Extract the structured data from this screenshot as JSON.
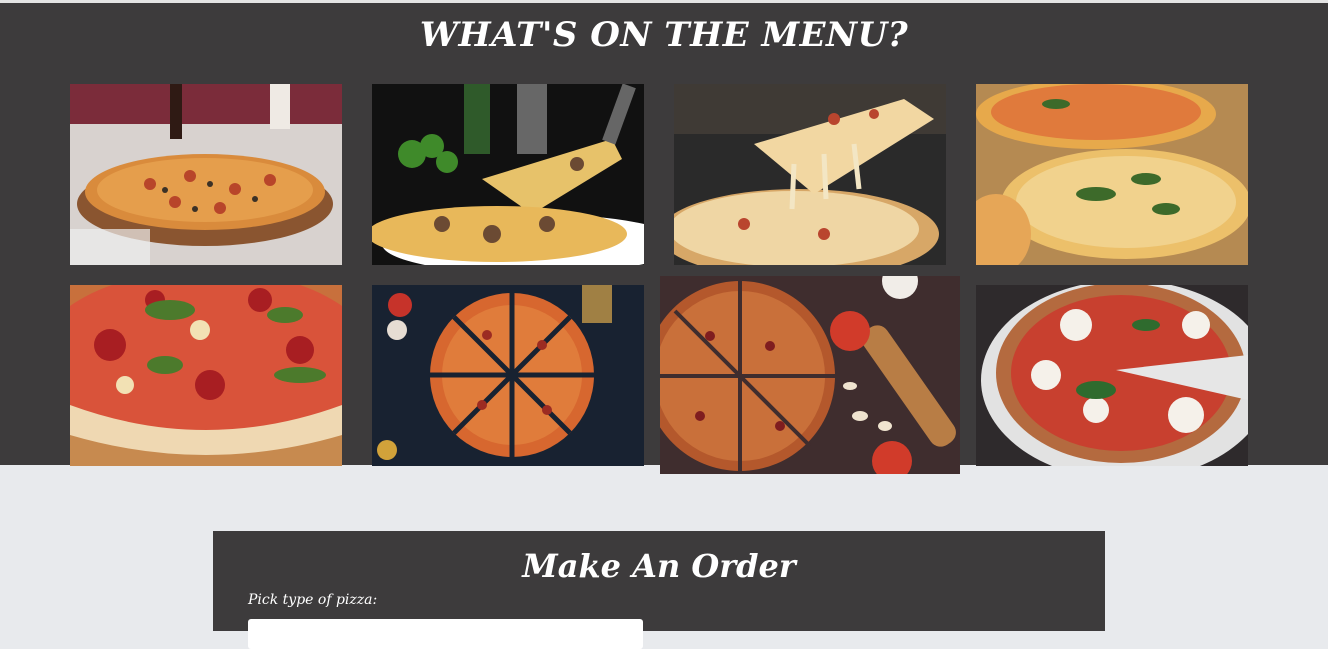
{
  "menu": {
    "title": "WHAT'S ON THE MENU?",
    "images": [
      {
        "name": "pepperoni-olive-pizza-photo",
        "theme": "table-classic"
      },
      {
        "name": "mushroom-slice-server-photo",
        "theme": "dark-server"
      },
      {
        "name": "cheese-pull-pizza-photo",
        "theme": "cheese-pull"
      },
      {
        "name": "margherita-basil-pizza-photo",
        "theme": "golden-basil"
      },
      {
        "name": "tomato-basil-closeup-photo",
        "theme": "tomato-closeup"
      },
      {
        "name": "sliced-pizza-dark-board-photo",
        "theme": "dark-slices"
      },
      {
        "name": "rolling-pin-pizza-photo",
        "theme": "rolling-pin"
      },
      {
        "name": "mozzarella-neapolitan-photo",
        "theme": "neapolitan"
      }
    ]
  },
  "order": {
    "title": "Make An Order",
    "pizza_type_label": "Pick type of pizza:"
  },
  "colors": {
    "panel": "#3d3b3c",
    "page_background": "#e8eaed",
    "text": "#ffffff"
  }
}
